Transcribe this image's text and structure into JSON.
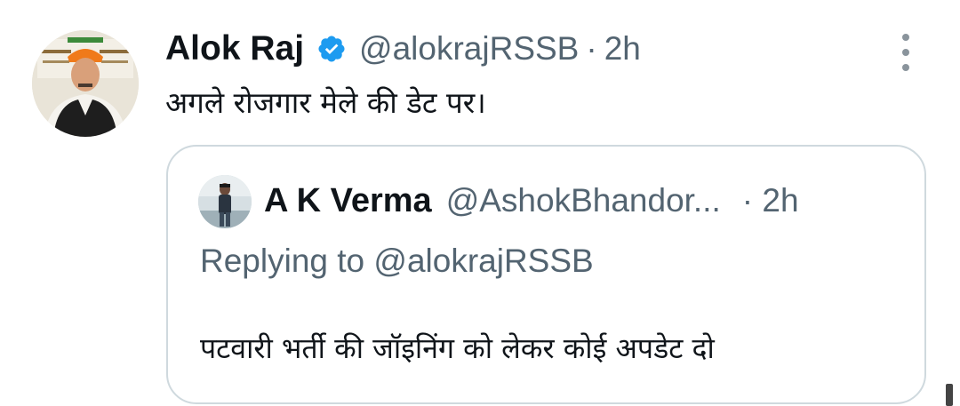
{
  "tweet": {
    "author_name": "Alok Raj",
    "author_handle": "@alokrajRSSB",
    "separator": "·",
    "time": "2h",
    "text": "अगले रोजगार मेले की डेट पर।",
    "verified_icon": "verified-badge-icon",
    "more_icon": "more-options-icon"
  },
  "quoted_tweet": {
    "author_name": "A K Verma",
    "author_handle": "@AshokBhandor...",
    "time": "· 2h",
    "replying_to": "Replying to @alokrajRSSB",
    "text": "पटवारी भर्ती की जॉइनिंग को लेकर कोई अपडेट दो"
  },
  "colors": {
    "text_primary": "#0f1419",
    "text_secondary": "#536471",
    "verified_blue": "#1d9bf0",
    "border": "#cfd9de"
  }
}
